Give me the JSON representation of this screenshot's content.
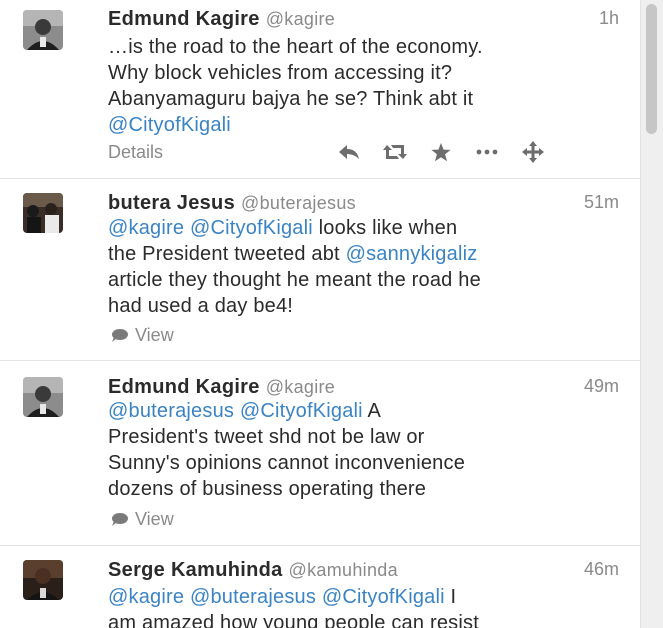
{
  "tweets": [
    {
      "name": "Edmund Kagire",
      "handle": "@kagire",
      "time": "1h",
      "lines": [
        [
          {
            "t": "…is the road to the heart of the economy."
          }
        ],
        [
          {
            "t": "Why block vehicles from accessing it?"
          }
        ],
        [
          {
            "t": "Abanyamaguru bajya he se? Think abt it"
          }
        ],
        [
          {
            "t": "@CityofKigali",
            "m": true
          }
        ]
      ],
      "details_label": "Details",
      "actions": [
        "reply-icon",
        "retweet-icon",
        "favorite-icon",
        "more-icon",
        "expand-icon"
      ]
    },
    {
      "name": "butera Jesus",
      "handle": "@buterajesus",
      "time": "51m",
      "lines": [
        [
          {
            "t": "@kagire",
            "m": true
          },
          {
            "t": " "
          },
          {
            "t": "@CityofKigali",
            "m": true
          },
          {
            "t": " looks like when"
          }
        ],
        [
          {
            "t": "the President tweeted abt "
          },
          {
            "t": "@sannykigaliz",
            "m": true
          }
        ],
        [
          {
            "t": "article they thought he meant the road he"
          }
        ],
        [
          {
            "t": "had used a day be4!"
          }
        ]
      ],
      "view_label": "View"
    },
    {
      "name": "Edmund Kagire",
      "handle": "@kagire",
      "time": "49m",
      "lines": [
        [
          {
            "t": "@buterajesus",
            "m": true
          },
          {
            "t": " "
          },
          {
            "t": "@CityofKigali",
            "m": true
          },
          {
            "t": " A"
          }
        ],
        [
          {
            "t": "President's tweet shd not be law or"
          }
        ],
        [
          {
            "t": "Sunny's opinions cannot inconvenience"
          }
        ],
        [
          {
            "t": "dozens of business operating there"
          }
        ]
      ],
      "view_label": "View"
    },
    {
      "name": "Serge Kamuhinda",
      "handle": "@kamuhinda",
      "time": "46m",
      "lines": [
        [
          {
            "t": "@kagire",
            "m": true
          },
          {
            "t": " "
          },
          {
            "t": "@buterajesus",
            "m": true
          },
          {
            "t": " "
          },
          {
            "t": "@CityofKigali",
            "m": true
          },
          {
            "t": " I"
          }
        ],
        [
          {
            "t": "am amazed how young people can resist"
          }
        ]
      ]
    }
  ],
  "colors": {
    "mention": "#3b84c4",
    "muted": "#8a8a8a",
    "text": "#2b2b2b"
  }
}
